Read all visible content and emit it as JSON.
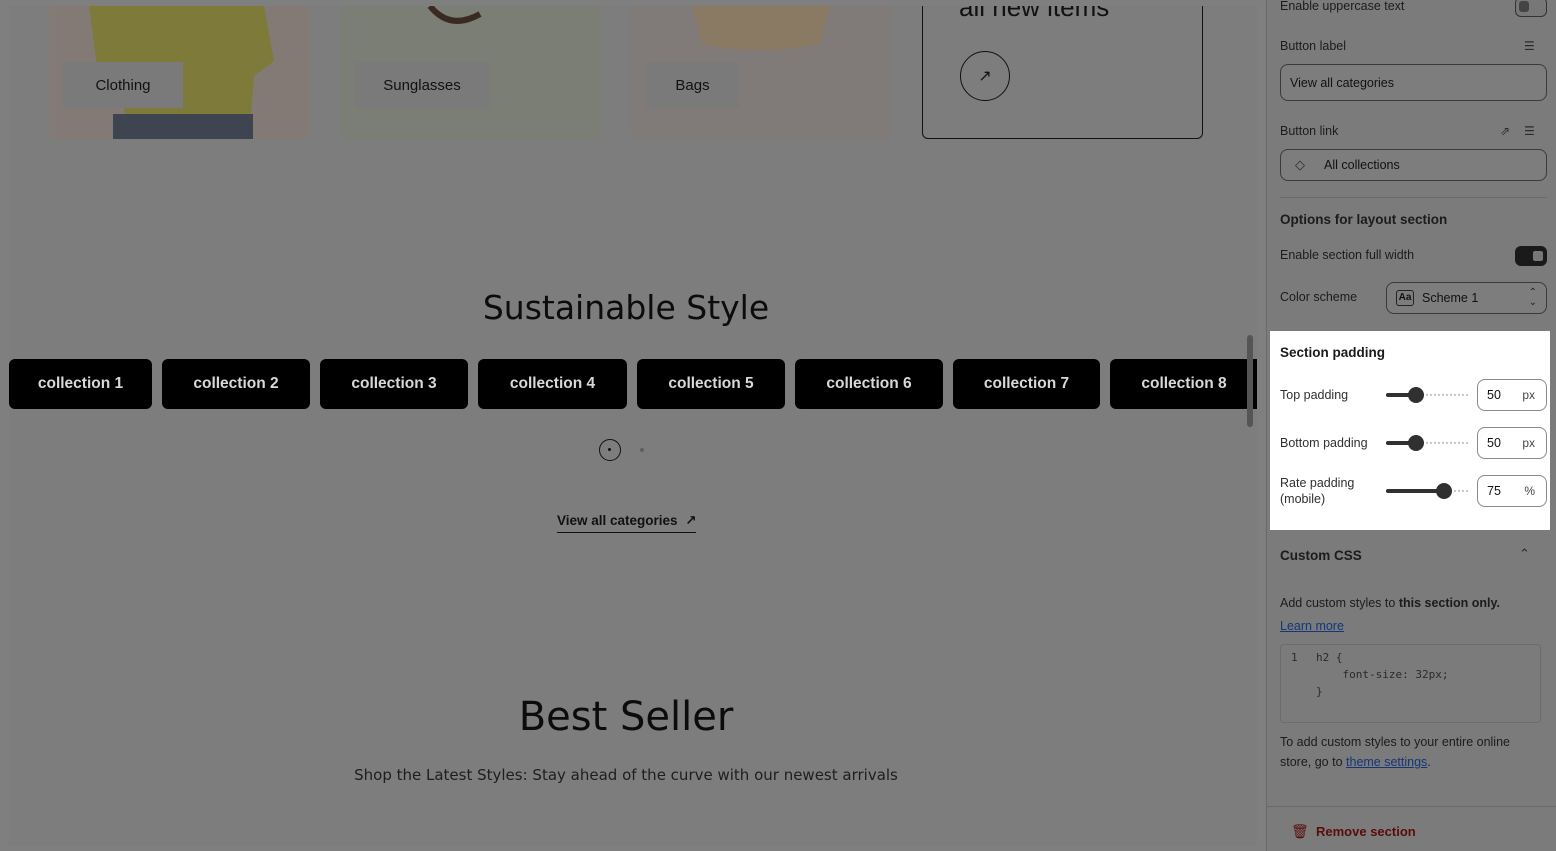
{
  "preview": {
    "categories": [
      "Clothing",
      "Sunglasses",
      "Bags"
    ],
    "new_items_text": "all new items",
    "sustainable_title": "Sustainable Style",
    "collections": [
      "collection 1",
      "collection 2",
      "collection 3",
      "collection 4",
      "collection 5",
      "collection 6",
      "collection 7",
      "collection 8"
    ],
    "view_all_label": "View all categories",
    "view_all_icon": "arrow-up-right-icon",
    "bestseller_title": "Best Seller",
    "bestseller_subtitle": "Shop the Latest Styles: Stay ahead of the curve with our newest arrivals"
  },
  "panel": {
    "uppercase_label": "Enable uppercase text",
    "button_label_title": "Button label",
    "button_label_value": "View all categories",
    "button_link_title": "Button link",
    "button_link_value": "All collections",
    "layout_heading": "Options for layout section",
    "full_width_label": "Enable section full width",
    "color_scheme_label": "Color scheme",
    "color_scheme_value": "Scheme 1",
    "color_scheme_badge": "Aa",
    "padding": {
      "heading": "Section padding",
      "top_label": "Top padding",
      "top_value": "50",
      "top_unit": "px",
      "bottom_label": "Bottom padding",
      "bottom_value": "50",
      "bottom_unit": "px",
      "rate_label": "Rate padding",
      "rate_label_2": "(mobile)",
      "rate_value": "75",
      "rate_unit": "%",
      "top_fraction": 0.36,
      "bottom_fraction": 0.36,
      "rate_fraction": 0.7
    },
    "custom_css_heading": "Custom CSS",
    "custom_css_desc": "Add custom styles to ",
    "custom_css_desc_bold": "this section only.",
    "learn_more": "Learn more",
    "code_line_no": "1",
    "code_lines": [
      "h2 {",
      "    font-size: 32px;",
      "}"
    ],
    "footer_text_1": "To add custom styles to your entire online",
    "footer_text_2": "store, go to ",
    "theme_settings": "theme settings",
    "footer_period": ".",
    "remove_section": "Remove section"
  }
}
